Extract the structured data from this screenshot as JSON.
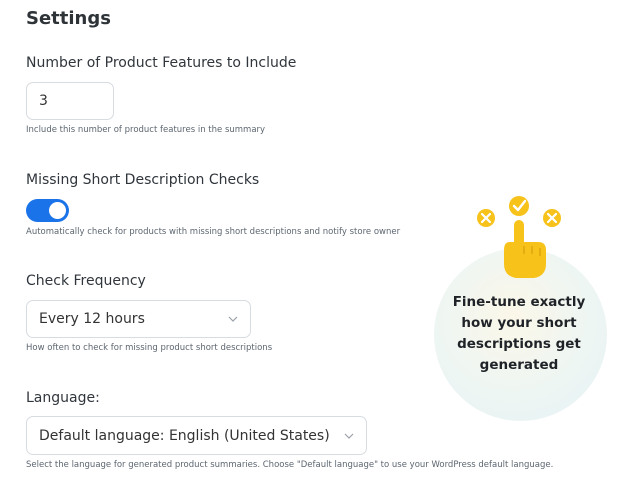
{
  "page": {
    "title": "Settings"
  },
  "features": {
    "label": "Number of Product Features to Include",
    "value": "3",
    "help": "Include this number of product features in the summary"
  },
  "missing": {
    "label": "Missing Short Description Checks",
    "enabled": true,
    "help": "Automatically check for products with missing short descriptions and notify store owner"
  },
  "frequency": {
    "label": "Check Frequency",
    "selected": "Every 12 hours",
    "help": "How often to check for missing product short descriptions"
  },
  "language": {
    "label": "Language:",
    "selected": "Default language: English (United States)",
    "help": "Select the language for generated product summaries. Choose \"Default language\" to use your WordPress default language."
  },
  "promo": {
    "line1": "Fine-tune exactly",
    "line2": "how your short",
    "line3": "descriptions get",
    "line4": "generated"
  },
  "colors": {
    "toggle_on": "#1a73e8",
    "icon_yellow": "#f7c21a"
  },
  "icons": {
    "select_arrow": "chevron-down-icon",
    "promo_hand": "pointing-hand-icon",
    "promo_check": "checkmark-icon",
    "promo_cross": "close-icon"
  }
}
